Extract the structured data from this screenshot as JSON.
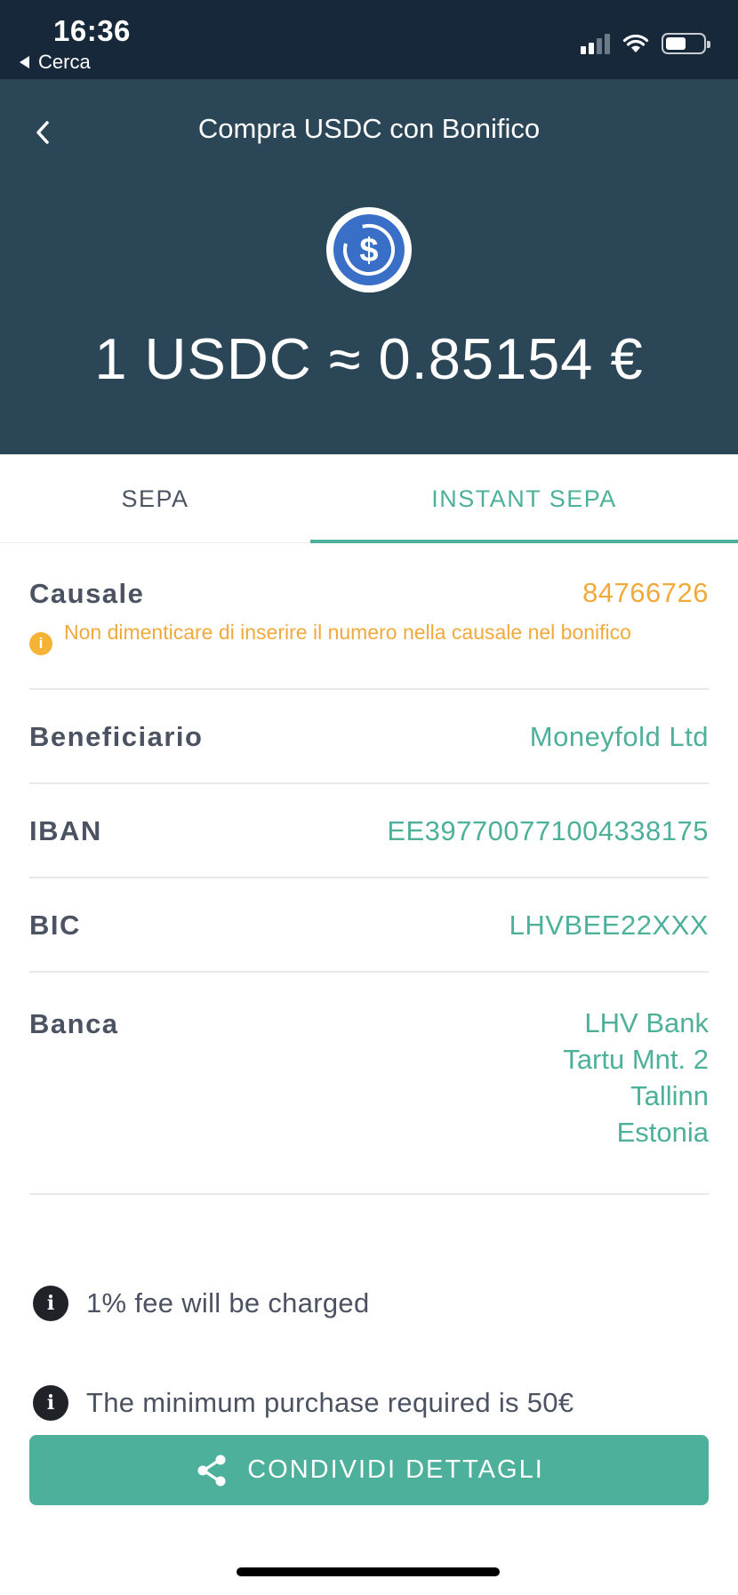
{
  "status_bar": {
    "time": "16:36",
    "back_app": "Cerca",
    "icons": [
      "signal-icon",
      "wifi-icon",
      "battery-icon"
    ]
  },
  "header": {
    "title": "Compra USDC con Bonifico",
    "back_icon": "chevron-left-icon",
    "coin_icon": "usdc-coin-icon",
    "rate": "1 USDC ≈ 0.85154 €"
  },
  "tabs": [
    {
      "label": "SEPA",
      "active": false
    },
    {
      "label": "INSTANT SEPA",
      "active": true
    }
  ],
  "details": {
    "causale": {
      "label": "Causale",
      "value": "84766726",
      "warning": "Non dimenticare di inserire il numero nella causale nel bonifico"
    },
    "beneficiario": {
      "label": "Beneficiario",
      "value": "Moneyfold Ltd"
    },
    "iban": {
      "label": "IBAN",
      "value": "EE397700771004338175"
    },
    "bic": {
      "label": "BIC",
      "value": "LHVBEE22XXX"
    },
    "banca": {
      "label": "Banca",
      "lines": [
        "LHV Bank",
        "Tartu Mnt. 2",
        "Tallinn",
        "Estonia"
      ]
    }
  },
  "notices": [
    {
      "text": "1% fee will be charged",
      "icon": "info-icon"
    },
    {
      "text": "The minimum purchase required is 50€",
      "icon": "info-icon"
    }
  ],
  "share_button": {
    "label": "CONDIVIDI DETTAGLI",
    "icon": "share-icon"
  },
  "colors": {
    "header_bg": "#2b4757",
    "status_bg": "#16283a",
    "accent": "#4db09a",
    "warning": "#f2a93b",
    "usdc_blue": "#3a6fc8"
  }
}
